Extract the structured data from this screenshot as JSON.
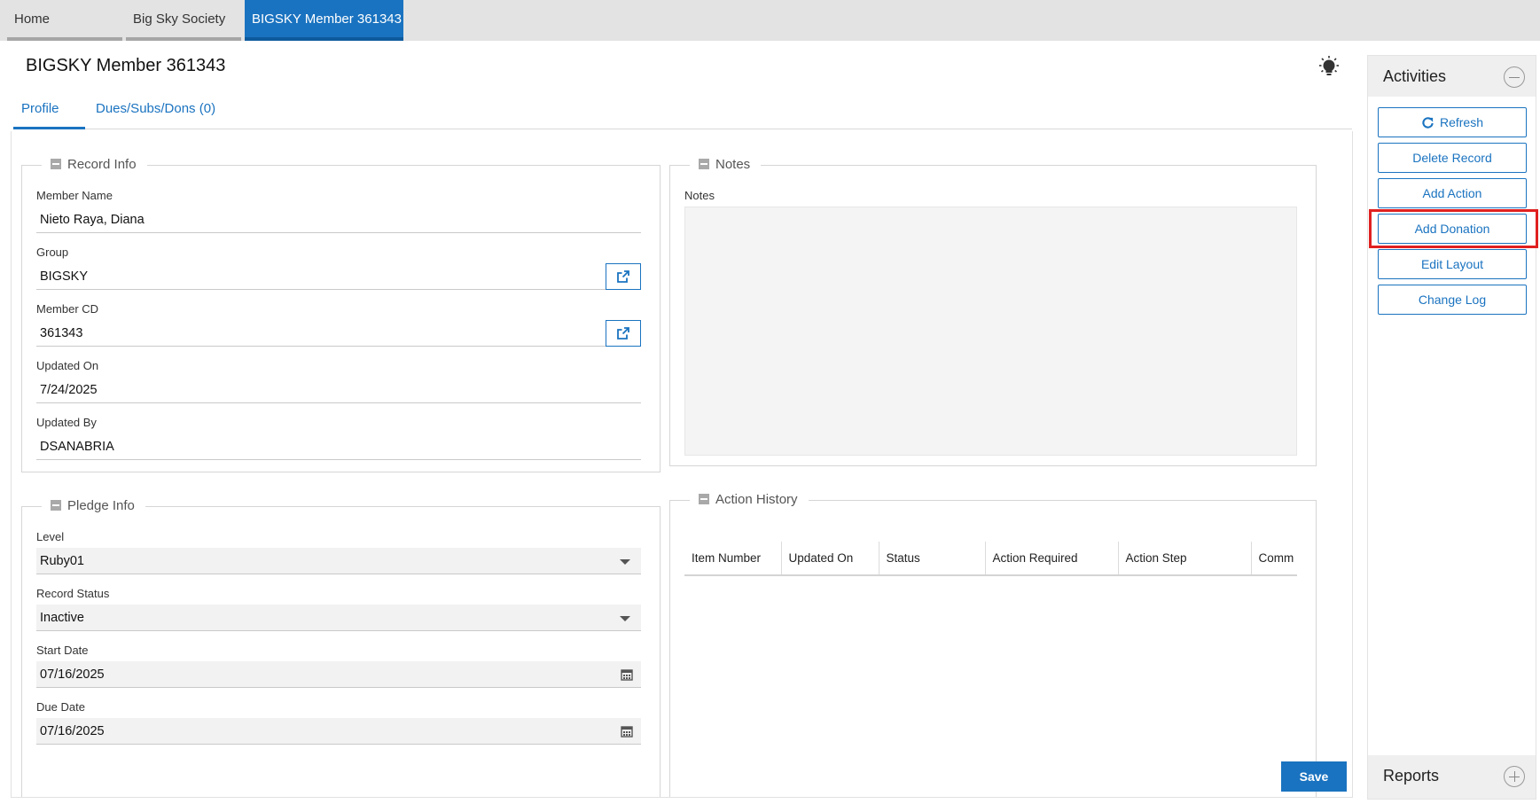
{
  "top_tabs": [
    {
      "label": "Home",
      "active": false
    },
    {
      "label": "Big Sky Society",
      "active": false
    },
    {
      "label": "BIGSKY Member 361343",
      "active": true
    }
  ],
  "page": {
    "title": "BIGSKY Member 361343"
  },
  "sub_tabs": [
    {
      "label": "Profile",
      "active": true
    },
    {
      "label": "Dues/Subs/Dons (0)",
      "active": false
    }
  ],
  "record_info": {
    "legend": "Record Info",
    "member_name": {
      "label": "Member Name",
      "value": "Nieto Raya, Diana"
    },
    "group": {
      "label": "Group",
      "value": "BIGSKY"
    },
    "member_cd": {
      "label": "Member CD",
      "value": "361343"
    },
    "updated_on": {
      "label": "Updated On",
      "value": "7/24/2025"
    },
    "updated_by": {
      "label": "Updated By",
      "value": "DSANABRIA"
    }
  },
  "pledge_info": {
    "legend": "Pledge Info",
    "level": {
      "label": "Level",
      "value": "Ruby01"
    },
    "record_status": {
      "label": "Record Status",
      "value": "Inactive"
    },
    "start_date": {
      "label": "Start Date",
      "value": "07/16/2025"
    },
    "due_date": {
      "label": "Due Date",
      "value": "07/16/2025"
    }
  },
  "notes": {
    "legend": "Notes",
    "label": "Notes",
    "value": ""
  },
  "action_history": {
    "legend": "Action History",
    "columns": [
      "Item Number",
      "Updated On",
      "Status",
      "Action Required",
      "Action Step",
      "Comm"
    ]
  },
  "save_label": "Save",
  "activities": {
    "title": "Activities",
    "buttons": [
      "Refresh",
      "Delete Record",
      "Add Action",
      "Add Donation",
      "Edit Layout",
      "Change Log"
    ],
    "highlighted": "Add Donation"
  },
  "reports": {
    "title": "Reports"
  },
  "colors": {
    "accent": "#1a73c0",
    "highlight": "#e02020"
  },
  "icons": [
    "lightbulb-icon",
    "external-link-icon",
    "dropdown-arrow-icon",
    "calendar-icon",
    "refresh-icon",
    "collapse-icon",
    "expand-icon"
  ]
}
